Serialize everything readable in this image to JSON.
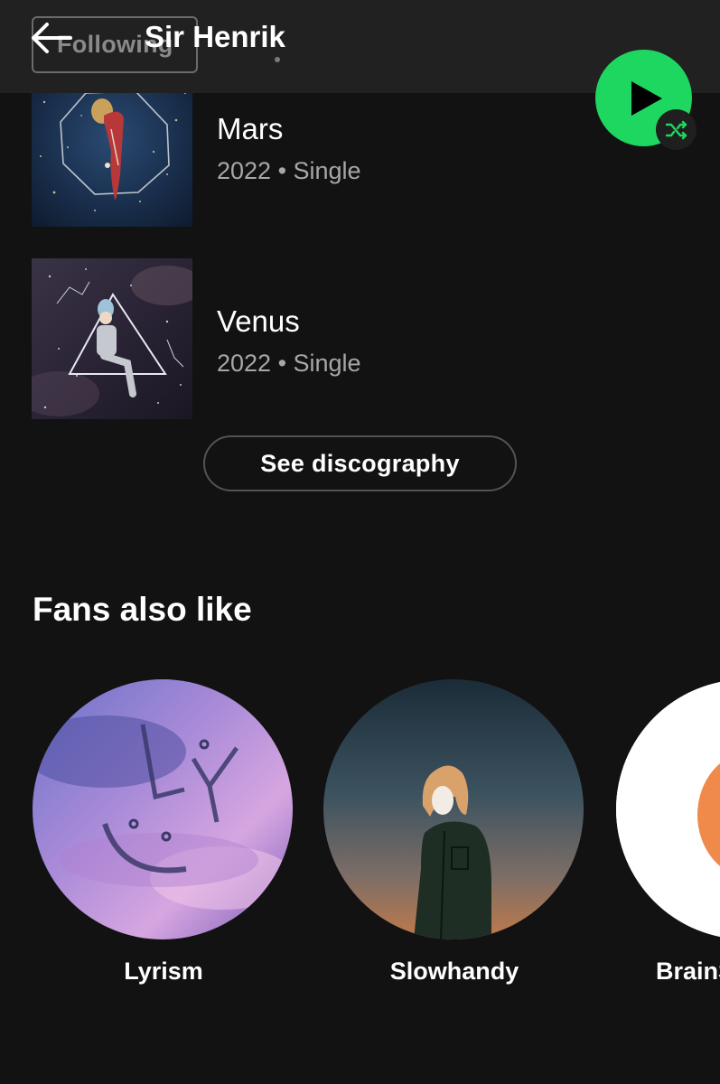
{
  "header": {
    "following_label": "Following",
    "artist_name": "Sir Henrik"
  },
  "colors": {
    "accent": "#1ed760",
    "background": "#121212",
    "header": "#212121",
    "secondary_text": "#a7a7a7"
  },
  "icons": {
    "back": "back-arrow-icon",
    "play": "play-icon",
    "shuffle": "shuffle-icon"
  },
  "releases": [
    {
      "title": "Mars",
      "meta": "2022 • Single"
    },
    {
      "title": "Venus",
      "meta": "2022 • Single"
    }
  ],
  "see_discography_label": "See discography",
  "fans_section": {
    "title": "Fans also like",
    "artists": [
      {
        "name": "Lyrism"
      },
      {
        "name": "Slowhandy"
      },
      {
        "name": "BrainS"
      }
    ]
  }
}
